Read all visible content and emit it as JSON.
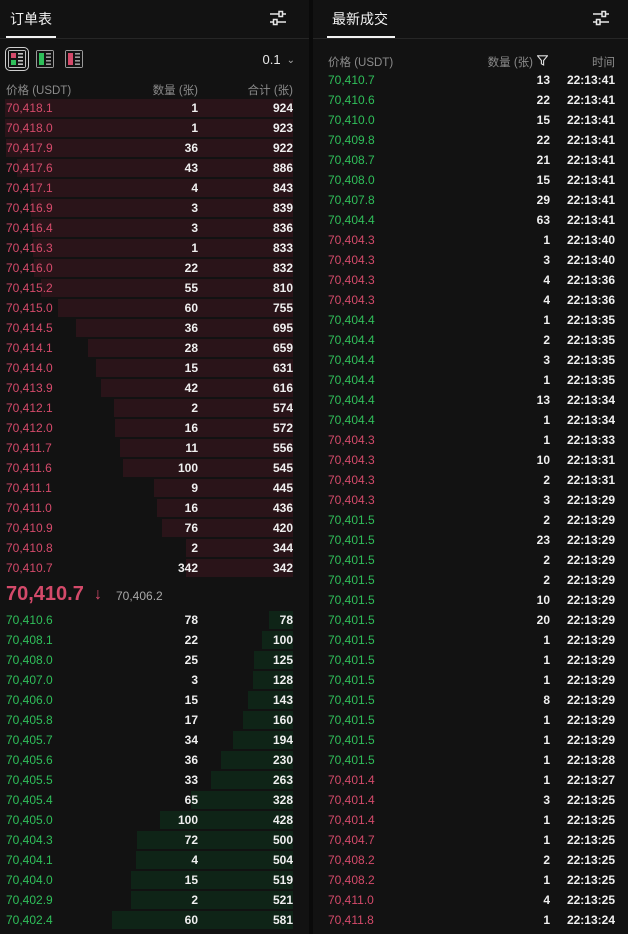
{
  "orderbook": {
    "title": "订单表",
    "precision": "0.1",
    "columns": {
      "price": "价格 (USDT)",
      "qty": "数量 (张)",
      "total": "合计 (张)"
    },
    "asks": [
      {
        "price": "70,418.1",
        "qty": "1",
        "total": "924"
      },
      {
        "price": "70,418.0",
        "qty": "1",
        "total": "923"
      },
      {
        "price": "70,417.9",
        "qty": "36",
        "total": "922"
      },
      {
        "price": "70,417.6",
        "qty": "43",
        "total": "886"
      },
      {
        "price": "70,417.1",
        "qty": "4",
        "total": "843"
      },
      {
        "price": "70,416.9",
        "qty": "3",
        "total": "839"
      },
      {
        "price": "70,416.4",
        "qty": "3",
        "total": "836"
      },
      {
        "price": "70,416.3",
        "qty": "1",
        "total": "833"
      },
      {
        "price": "70,416.0",
        "qty": "22",
        "total": "832"
      },
      {
        "price": "70,415.2",
        "qty": "55",
        "total": "810"
      },
      {
        "price": "70,415.0",
        "qty": "60",
        "total": "755"
      },
      {
        "price": "70,414.5",
        "qty": "36",
        "total": "695"
      },
      {
        "price": "70,414.1",
        "qty": "28",
        "total": "659"
      },
      {
        "price": "70,414.0",
        "qty": "15",
        "total": "631"
      },
      {
        "price": "70,413.9",
        "qty": "42",
        "total": "616"
      },
      {
        "price": "70,412.1",
        "qty": "2",
        "total": "574"
      },
      {
        "price": "70,412.0",
        "qty": "16",
        "total": "572"
      },
      {
        "price": "70,411.7",
        "qty": "11",
        "total": "556"
      },
      {
        "price": "70,411.6",
        "qty": "100",
        "total": "545"
      },
      {
        "price": "70,411.1",
        "qty": "9",
        "total": "445"
      },
      {
        "price": "70,411.0",
        "qty": "16",
        "total": "436"
      },
      {
        "price": "70,410.9",
        "qty": "76",
        "total": "420"
      },
      {
        "price": "70,410.8",
        "qty": "2",
        "total": "344"
      },
      {
        "price": "70,410.7",
        "qty": "342",
        "total": "342"
      }
    ],
    "last_price": "70,410.7",
    "last_arrow": "↓",
    "mark_price": "70,406.2",
    "bids": [
      {
        "price": "70,410.6",
        "qty": "78",
        "total": "78"
      },
      {
        "price": "70,408.1",
        "qty": "22",
        "total": "100"
      },
      {
        "price": "70,408.0",
        "qty": "25",
        "total": "125"
      },
      {
        "price": "70,407.0",
        "qty": "3",
        "total": "128"
      },
      {
        "price": "70,406.0",
        "qty": "15",
        "total": "143"
      },
      {
        "price": "70,405.8",
        "qty": "17",
        "total": "160"
      },
      {
        "price": "70,405.7",
        "qty": "34",
        "total": "194"
      },
      {
        "price": "70,405.6",
        "qty": "36",
        "total": "230"
      },
      {
        "price": "70,405.5",
        "qty": "33",
        "total": "263"
      },
      {
        "price": "70,405.4",
        "qty": "65",
        "total": "328"
      },
      {
        "price": "70,405.0",
        "qty": "100",
        "total": "428"
      },
      {
        "price": "70,404.3",
        "qty": "72",
        "total": "500"
      },
      {
        "price": "70,404.1",
        "qty": "4",
        "total": "504"
      },
      {
        "price": "70,404.0",
        "qty": "15",
        "total": "519"
      },
      {
        "price": "70,402.9",
        "qty": "2",
        "total": "521"
      },
      {
        "price": "70,402.4",
        "qty": "60",
        "total": "581"
      }
    ]
  },
  "trades": {
    "title": "最新成交",
    "columns": {
      "price": "价格 (USDT)",
      "qty": "数量 (张)",
      "time": "时间"
    },
    "list": [
      {
        "price": "70,410.7",
        "qty": "13",
        "time": "22:13:41",
        "side": "buy"
      },
      {
        "price": "70,410.6",
        "qty": "22",
        "time": "22:13:41",
        "side": "buy"
      },
      {
        "price": "70,410.0",
        "qty": "15",
        "time": "22:13:41",
        "side": "buy"
      },
      {
        "price": "70,409.8",
        "qty": "22",
        "time": "22:13:41",
        "side": "buy"
      },
      {
        "price": "70,408.7",
        "qty": "21",
        "time": "22:13:41",
        "side": "buy"
      },
      {
        "price": "70,408.0",
        "qty": "15",
        "time": "22:13:41",
        "side": "buy"
      },
      {
        "price": "70,407.8",
        "qty": "29",
        "time": "22:13:41",
        "side": "buy"
      },
      {
        "price": "70,404.4",
        "qty": "63",
        "time": "22:13:41",
        "side": "buy"
      },
      {
        "price": "70,404.3",
        "qty": "1",
        "time": "22:13:40",
        "side": "sell"
      },
      {
        "price": "70,404.3",
        "qty": "3",
        "time": "22:13:40",
        "side": "sell"
      },
      {
        "price": "70,404.3",
        "qty": "4",
        "time": "22:13:36",
        "side": "sell"
      },
      {
        "price": "70,404.3",
        "qty": "4",
        "time": "22:13:36",
        "side": "sell"
      },
      {
        "price": "70,404.4",
        "qty": "1",
        "time": "22:13:35",
        "side": "buy"
      },
      {
        "price": "70,404.4",
        "qty": "2",
        "time": "22:13:35",
        "side": "buy"
      },
      {
        "price": "70,404.4",
        "qty": "3",
        "time": "22:13:35",
        "side": "buy"
      },
      {
        "price": "70,404.4",
        "qty": "1",
        "time": "22:13:35",
        "side": "buy"
      },
      {
        "price": "70,404.4",
        "qty": "13",
        "time": "22:13:34",
        "side": "buy"
      },
      {
        "price": "70,404.4",
        "qty": "1",
        "time": "22:13:34",
        "side": "buy"
      },
      {
        "price": "70,404.3",
        "qty": "1",
        "time": "22:13:33",
        "side": "sell"
      },
      {
        "price": "70,404.3",
        "qty": "10",
        "time": "22:13:31",
        "side": "sell"
      },
      {
        "price": "70,404.3",
        "qty": "2",
        "time": "22:13:31",
        "side": "sell"
      },
      {
        "price": "70,404.3",
        "qty": "3",
        "time": "22:13:29",
        "side": "sell"
      },
      {
        "price": "70,401.5",
        "qty": "2",
        "time": "22:13:29",
        "side": "buy"
      },
      {
        "price": "70,401.5",
        "qty": "23",
        "time": "22:13:29",
        "side": "buy"
      },
      {
        "price": "70,401.5",
        "qty": "2",
        "time": "22:13:29",
        "side": "buy"
      },
      {
        "price": "70,401.5",
        "qty": "2",
        "time": "22:13:29",
        "side": "buy"
      },
      {
        "price": "70,401.5",
        "qty": "10",
        "time": "22:13:29",
        "side": "buy"
      },
      {
        "price": "70,401.5",
        "qty": "20",
        "time": "22:13:29",
        "side": "buy"
      },
      {
        "price": "70,401.5",
        "qty": "1",
        "time": "22:13:29",
        "side": "buy"
      },
      {
        "price": "70,401.5",
        "qty": "1",
        "time": "22:13:29",
        "side": "buy"
      },
      {
        "price": "70,401.5",
        "qty": "1",
        "time": "22:13:29",
        "side": "buy"
      },
      {
        "price": "70,401.5",
        "qty": "8",
        "time": "22:13:29",
        "side": "buy"
      },
      {
        "price": "70,401.5",
        "qty": "1",
        "time": "22:13:29",
        "side": "buy"
      },
      {
        "price": "70,401.5",
        "qty": "1",
        "time": "22:13:29",
        "side": "buy"
      },
      {
        "price": "70,401.5",
        "qty": "1",
        "time": "22:13:28",
        "side": "buy"
      },
      {
        "price": "70,401.4",
        "qty": "1",
        "time": "22:13:27",
        "side": "sell"
      },
      {
        "price": "70,401.4",
        "qty": "3",
        "time": "22:13:25",
        "side": "sell"
      },
      {
        "price": "70,401.4",
        "qty": "1",
        "time": "22:13:25",
        "side": "sell"
      },
      {
        "price": "70,404.7",
        "qty": "1",
        "time": "22:13:25",
        "side": "sell"
      },
      {
        "price": "70,408.2",
        "qty": "2",
        "time": "22:13:25",
        "side": "sell"
      },
      {
        "price": "70,408.2",
        "qty": "1",
        "time": "22:13:25",
        "side": "sell"
      },
      {
        "price": "70,411.0",
        "qty": "4",
        "time": "22:13:25",
        "side": "sell"
      },
      {
        "price": "70,411.8",
        "qty": "1",
        "time": "22:13:24",
        "side": "sell"
      }
    ]
  },
  "colors": {
    "buy": "#2fbf5a",
    "sell": "#d44a6a",
    "background": "#121212"
  },
  "icons": {
    "settings": "sliders-icon",
    "view_both": "book-both-icon",
    "view_bids": "book-bids-icon",
    "view_asks": "book-asks-icon",
    "filter": "filter-icon",
    "chevron": "chevron-down-icon",
    "arrow": "arrow-down-icon"
  }
}
